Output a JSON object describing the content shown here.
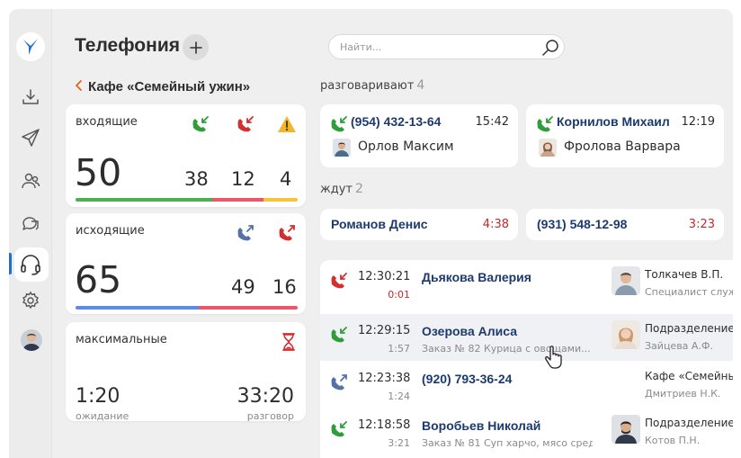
{
  "app": {
    "title": "Телефония"
  },
  "search": {
    "placeholder": "Найти..."
  },
  "breadcrumb": {
    "back_icon": "chevron-left-icon",
    "name": "Кафе «Семейный ужин»"
  },
  "colors": {
    "green": "#2e9d3a",
    "red": "#d32f2f",
    "blue": "#5572a8",
    "yellow": "#f3c53b",
    "navy": "#1d3a6e",
    "accent": "#1f6fd1"
  },
  "stats": {
    "incoming": {
      "label": "входящие",
      "total": "50",
      "answered": "38",
      "missed": "12",
      "warnings": "4",
      "icons": [
        "incoming-call-icon",
        "missed-call-icon",
        "warning-icon"
      ]
    },
    "outgoing": {
      "label": "исходящие",
      "total": "65",
      "answered": "49",
      "missed": "16",
      "icons": [
        "outgoing-call-icon",
        "outgoing-failed-icon"
      ]
    },
    "maximums": {
      "label": "максимальные",
      "icon": "hourglass-icon",
      "wait_value": "1:20",
      "wait_label": "ожидание",
      "talk_value": "33:20",
      "talk_label": "разговор"
    }
  },
  "talking": {
    "label": "разговаривают",
    "count": "4",
    "items": [
      {
        "caller": "(954) 432-13-64",
        "time": "15:42",
        "agent": "Орлов Максим"
      },
      {
        "caller": "Корнилов Михаил",
        "time": "12:19",
        "agent": "Фролова Варвара"
      }
    ]
  },
  "waiting": {
    "label": "ждут",
    "count": "2",
    "items": [
      {
        "caller": "Романов Денис",
        "time": "4:38"
      },
      {
        "caller": "(931) 548-12-98",
        "time": "3:23"
      }
    ]
  },
  "history": [
    {
      "direction": "missed",
      "time": "12:30:21",
      "duration": "0:01",
      "caller": "Дьякова Валерия",
      "order": "",
      "agent_name": "Толкачев В.П.",
      "agent_role": "Специалист служ"
    },
    {
      "direction": "incoming",
      "time": "12:29:15",
      "duration": "1:57",
      "caller": "Озерова Алиса",
      "order": "Заказ № 82 Курица с овощами...",
      "agent_name": "Подразделение д",
      "agent_role": "Зайцева А.Ф."
    },
    {
      "direction": "outgoing",
      "time": "12:23:38",
      "duration": "1:24",
      "caller": "(920) 793-36-24",
      "order": "",
      "agent_name": "Кафе «Семейны",
      "agent_role": "Дмитриев Н.К."
    },
    {
      "direction": "incoming",
      "time": "12:18:58",
      "duration": "3:21",
      "caller": "Воробьев Николай",
      "order": "Заказ № 81 Суп харчо, мясо сред...",
      "agent_name": "Подразделение до",
      "agent_role": "Котов П.Н."
    }
  ]
}
